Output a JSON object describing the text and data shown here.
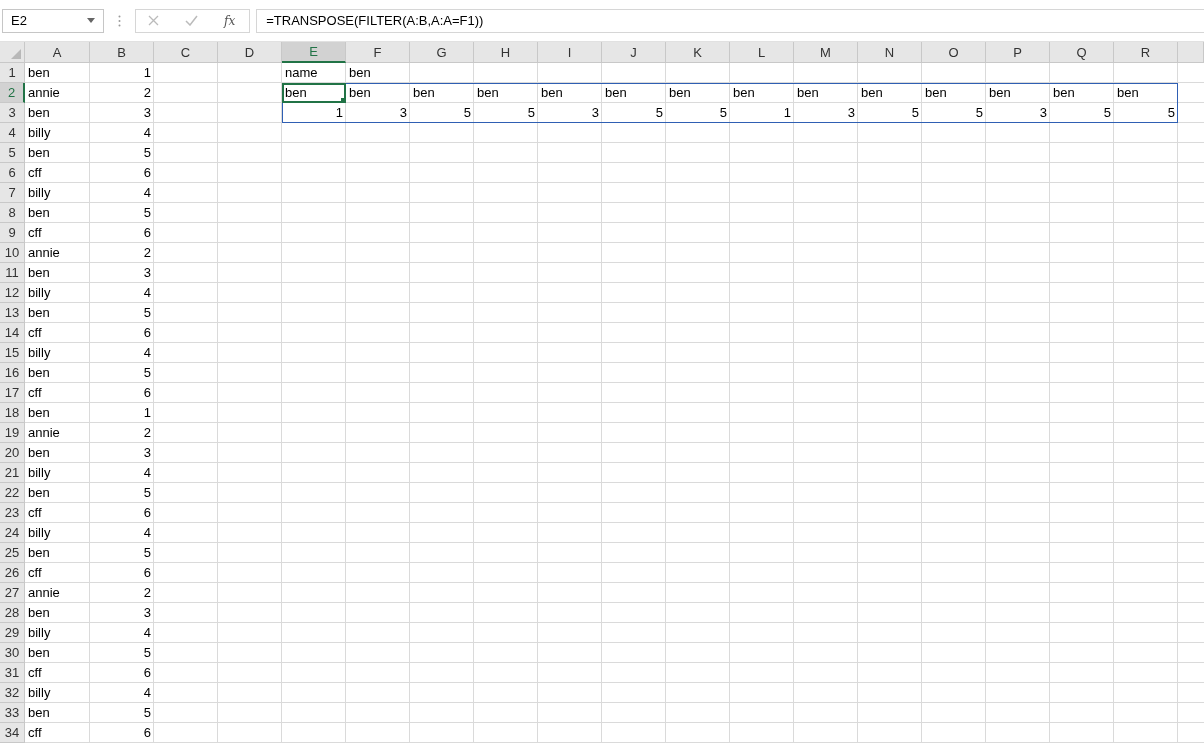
{
  "formula_bar": {
    "name_box": "E2",
    "function_label": "fx",
    "formula": "=TRANSPOSE(FILTER(A:B,A:A=F1))"
  },
  "columns": [
    {
      "label": "A",
      "selected": false
    },
    {
      "label": "B",
      "selected": false
    },
    {
      "label": "C",
      "selected": false
    },
    {
      "label": "D",
      "selected": false
    },
    {
      "label": "E",
      "selected": true
    },
    {
      "label": "F",
      "selected": false
    },
    {
      "label": "G",
      "selected": false
    },
    {
      "label": "H",
      "selected": false
    },
    {
      "label": "I",
      "selected": false
    },
    {
      "label": "J",
      "selected": false
    },
    {
      "label": "K",
      "selected": false
    },
    {
      "label": "L",
      "selected": false
    },
    {
      "label": "M",
      "selected": false
    },
    {
      "label": "N",
      "selected": false
    },
    {
      "label": "O",
      "selected": false
    },
    {
      "label": "P",
      "selected": false
    },
    {
      "label": "Q",
      "selected": false
    },
    {
      "label": "R",
      "selected": false
    }
  ],
  "rows": [
    {
      "label": "1",
      "selected": false,
      "cells": [
        {
          "text": "ben",
          "kind": "text"
        },
        {
          "text": "1",
          "kind": "number"
        },
        null,
        null,
        {
          "text": "name",
          "kind": "text"
        },
        {
          "text": "ben",
          "kind": "text"
        }
      ]
    },
    {
      "label": "2",
      "selected": true,
      "cells": [
        {
          "text": "annie",
          "kind": "text"
        },
        {
          "text": "2",
          "kind": "number"
        },
        null,
        null,
        {
          "text": "ben",
          "kind": "text",
          "spill": true,
          "active": true
        },
        {
          "text": "ben",
          "kind": "text",
          "spill": true
        },
        {
          "text": "ben",
          "kind": "text",
          "spill": true
        },
        {
          "text": "ben",
          "kind": "text",
          "spill": true
        },
        {
          "text": "ben",
          "kind": "text",
          "spill": true
        },
        {
          "text": "ben",
          "kind": "text",
          "spill": true
        },
        {
          "text": "ben",
          "kind": "text",
          "spill": true
        },
        {
          "text": "ben",
          "kind": "text",
          "spill": true
        },
        {
          "text": "ben",
          "kind": "text",
          "spill": true
        },
        {
          "text": "ben",
          "kind": "text",
          "spill": true
        },
        {
          "text": "ben",
          "kind": "text",
          "spill": true
        },
        {
          "text": "ben",
          "kind": "text",
          "spill": true
        },
        {
          "text": "ben",
          "kind": "text",
          "spill": true
        },
        {
          "text": "ben",
          "kind": "text",
          "spill": true
        }
      ]
    },
    {
      "label": "3",
      "selected": false,
      "cells": [
        {
          "text": "ben",
          "kind": "text"
        },
        {
          "text": "3",
          "kind": "number"
        },
        null,
        null,
        {
          "text": "1",
          "kind": "number",
          "spill": true
        },
        {
          "text": "3",
          "kind": "number",
          "spill": true
        },
        {
          "text": "5",
          "kind": "number",
          "spill": true
        },
        {
          "text": "5",
          "kind": "number",
          "spill": true
        },
        {
          "text": "3",
          "kind": "number",
          "spill": true
        },
        {
          "text": "5",
          "kind": "number",
          "spill": true
        },
        {
          "text": "5",
          "kind": "number",
          "spill": true
        },
        {
          "text": "1",
          "kind": "number",
          "spill": true
        },
        {
          "text": "3",
          "kind": "number",
          "spill": true
        },
        {
          "text": "5",
          "kind": "number",
          "spill": true
        },
        {
          "text": "5",
          "kind": "number",
          "spill": true
        },
        {
          "text": "3",
          "kind": "number",
          "spill": true
        },
        {
          "text": "5",
          "kind": "number",
          "spill": true
        },
        {
          "text": "5",
          "kind": "number",
          "spill": true
        }
      ]
    },
    {
      "label": "4",
      "selected": false,
      "cells": [
        {
          "text": "billy",
          "kind": "text"
        },
        {
          "text": "4",
          "kind": "number"
        }
      ]
    },
    {
      "label": "5",
      "selected": false,
      "cells": [
        {
          "text": "ben",
          "kind": "text"
        },
        {
          "text": "5",
          "kind": "number"
        }
      ]
    },
    {
      "label": "6",
      "selected": false,
      "cells": [
        {
          "text": "cff",
          "kind": "text"
        },
        {
          "text": "6",
          "kind": "number"
        }
      ]
    },
    {
      "label": "7",
      "selected": false,
      "cells": [
        {
          "text": "billy",
          "kind": "text"
        },
        {
          "text": "4",
          "kind": "number"
        }
      ]
    },
    {
      "label": "8",
      "selected": false,
      "cells": [
        {
          "text": "ben",
          "kind": "text"
        },
        {
          "text": "5",
          "kind": "number"
        }
      ]
    },
    {
      "label": "9",
      "selected": false,
      "cells": [
        {
          "text": "cff",
          "kind": "text"
        },
        {
          "text": "6",
          "kind": "number"
        }
      ]
    },
    {
      "label": "10",
      "selected": false,
      "cells": [
        {
          "text": "annie",
          "kind": "text"
        },
        {
          "text": "2",
          "kind": "number"
        }
      ]
    },
    {
      "label": "11",
      "selected": false,
      "cells": [
        {
          "text": "ben",
          "kind": "text"
        },
        {
          "text": "3",
          "kind": "number"
        }
      ]
    },
    {
      "label": "12",
      "selected": false,
      "cells": [
        {
          "text": "billy",
          "kind": "text"
        },
        {
          "text": "4",
          "kind": "number"
        }
      ]
    },
    {
      "label": "13",
      "selected": false,
      "cells": [
        {
          "text": "ben",
          "kind": "text"
        },
        {
          "text": "5",
          "kind": "number"
        }
      ]
    },
    {
      "label": "14",
      "selected": false,
      "cells": [
        {
          "text": "cff",
          "kind": "text"
        },
        {
          "text": "6",
          "kind": "number"
        }
      ]
    },
    {
      "label": "15",
      "selected": false,
      "cells": [
        {
          "text": "billy",
          "kind": "text"
        },
        {
          "text": "4",
          "kind": "number"
        }
      ]
    },
    {
      "label": "16",
      "selected": false,
      "cells": [
        {
          "text": "ben",
          "kind": "text"
        },
        {
          "text": "5",
          "kind": "number"
        }
      ]
    },
    {
      "label": "17",
      "selected": false,
      "cells": [
        {
          "text": "cff",
          "kind": "text"
        },
        {
          "text": "6",
          "kind": "number"
        }
      ]
    },
    {
      "label": "18",
      "selected": false,
      "cells": [
        {
          "text": "ben",
          "kind": "text"
        },
        {
          "text": "1",
          "kind": "number"
        }
      ]
    },
    {
      "label": "19",
      "selected": false,
      "cells": [
        {
          "text": "annie",
          "kind": "text"
        },
        {
          "text": "2",
          "kind": "number"
        }
      ]
    },
    {
      "label": "20",
      "selected": false,
      "cells": [
        {
          "text": "ben",
          "kind": "text"
        },
        {
          "text": "3",
          "kind": "number"
        }
      ]
    },
    {
      "label": "21",
      "selected": false,
      "cells": [
        {
          "text": "billy",
          "kind": "text"
        },
        {
          "text": "4",
          "kind": "number"
        }
      ]
    },
    {
      "label": "22",
      "selected": false,
      "cells": [
        {
          "text": "ben",
          "kind": "text"
        },
        {
          "text": "5",
          "kind": "number"
        }
      ]
    },
    {
      "label": "23",
      "selected": false,
      "cells": [
        {
          "text": "cff",
          "kind": "text"
        },
        {
          "text": "6",
          "kind": "number"
        }
      ]
    },
    {
      "label": "24",
      "selected": false,
      "cells": [
        {
          "text": "billy",
          "kind": "text"
        },
        {
          "text": "4",
          "kind": "number"
        }
      ]
    },
    {
      "label": "25",
      "selected": false,
      "cells": [
        {
          "text": "ben",
          "kind": "text"
        },
        {
          "text": "5",
          "kind": "number"
        }
      ]
    },
    {
      "label": "26",
      "selected": false,
      "cells": [
        {
          "text": "cff",
          "kind": "text"
        },
        {
          "text": "6",
          "kind": "number"
        }
      ]
    },
    {
      "label": "27",
      "selected": false,
      "cells": [
        {
          "text": "annie",
          "kind": "text"
        },
        {
          "text": "2",
          "kind": "number"
        }
      ]
    },
    {
      "label": "28",
      "selected": false,
      "cells": [
        {
          "text": "ben",
          "kind": "text"
        },
        {
          "text": "3",
          "kind": "number"
        }
      ]
    },
    {
      "label": "29",
      "selected": false,
      "cells": [
        {
          "text": "billy",
          "kind": "text"
        },
        {
          "text": "4",
          "kind": "number"
        }
      ]
    },
    {
      "label": "30",
      "selected": false,
      "cells": [
        {
          "text": "ben",
          "kind": "text"
        },
        {
          "text": "5",
          "kind": "number"
        }
      ]
    },
    {
      "label": "31",
      "selected": false,
      "cells": [
        {
          "text": "cff",
          "kind": "text"
        },
        {
          "text": "6",
          "kind": "number"
        }
      ]
    },
    {
      "label": "32",
      "selected": false,
      "cells": [
        {
          "text": "billy",
          "kind": "text"
        },
        {
          "text": "4",
          "kind": "number"
        }
      ]
    },
    {
      "label": "33",
      "selected": false,
      "cells": [
        {
          "text": "ben",
          "kind": "text"
        },
        {
          "text": "5",
          "kind": "number"
        }
      ]
    },
    {
      "label": "34",
      "selected": false,
      "cells": [
        {
          "text": "cff",
          "kind": "text"
        },
        {
          "text": "6",
          "kind": "number"
        }
      ]
    }
  ]
}
